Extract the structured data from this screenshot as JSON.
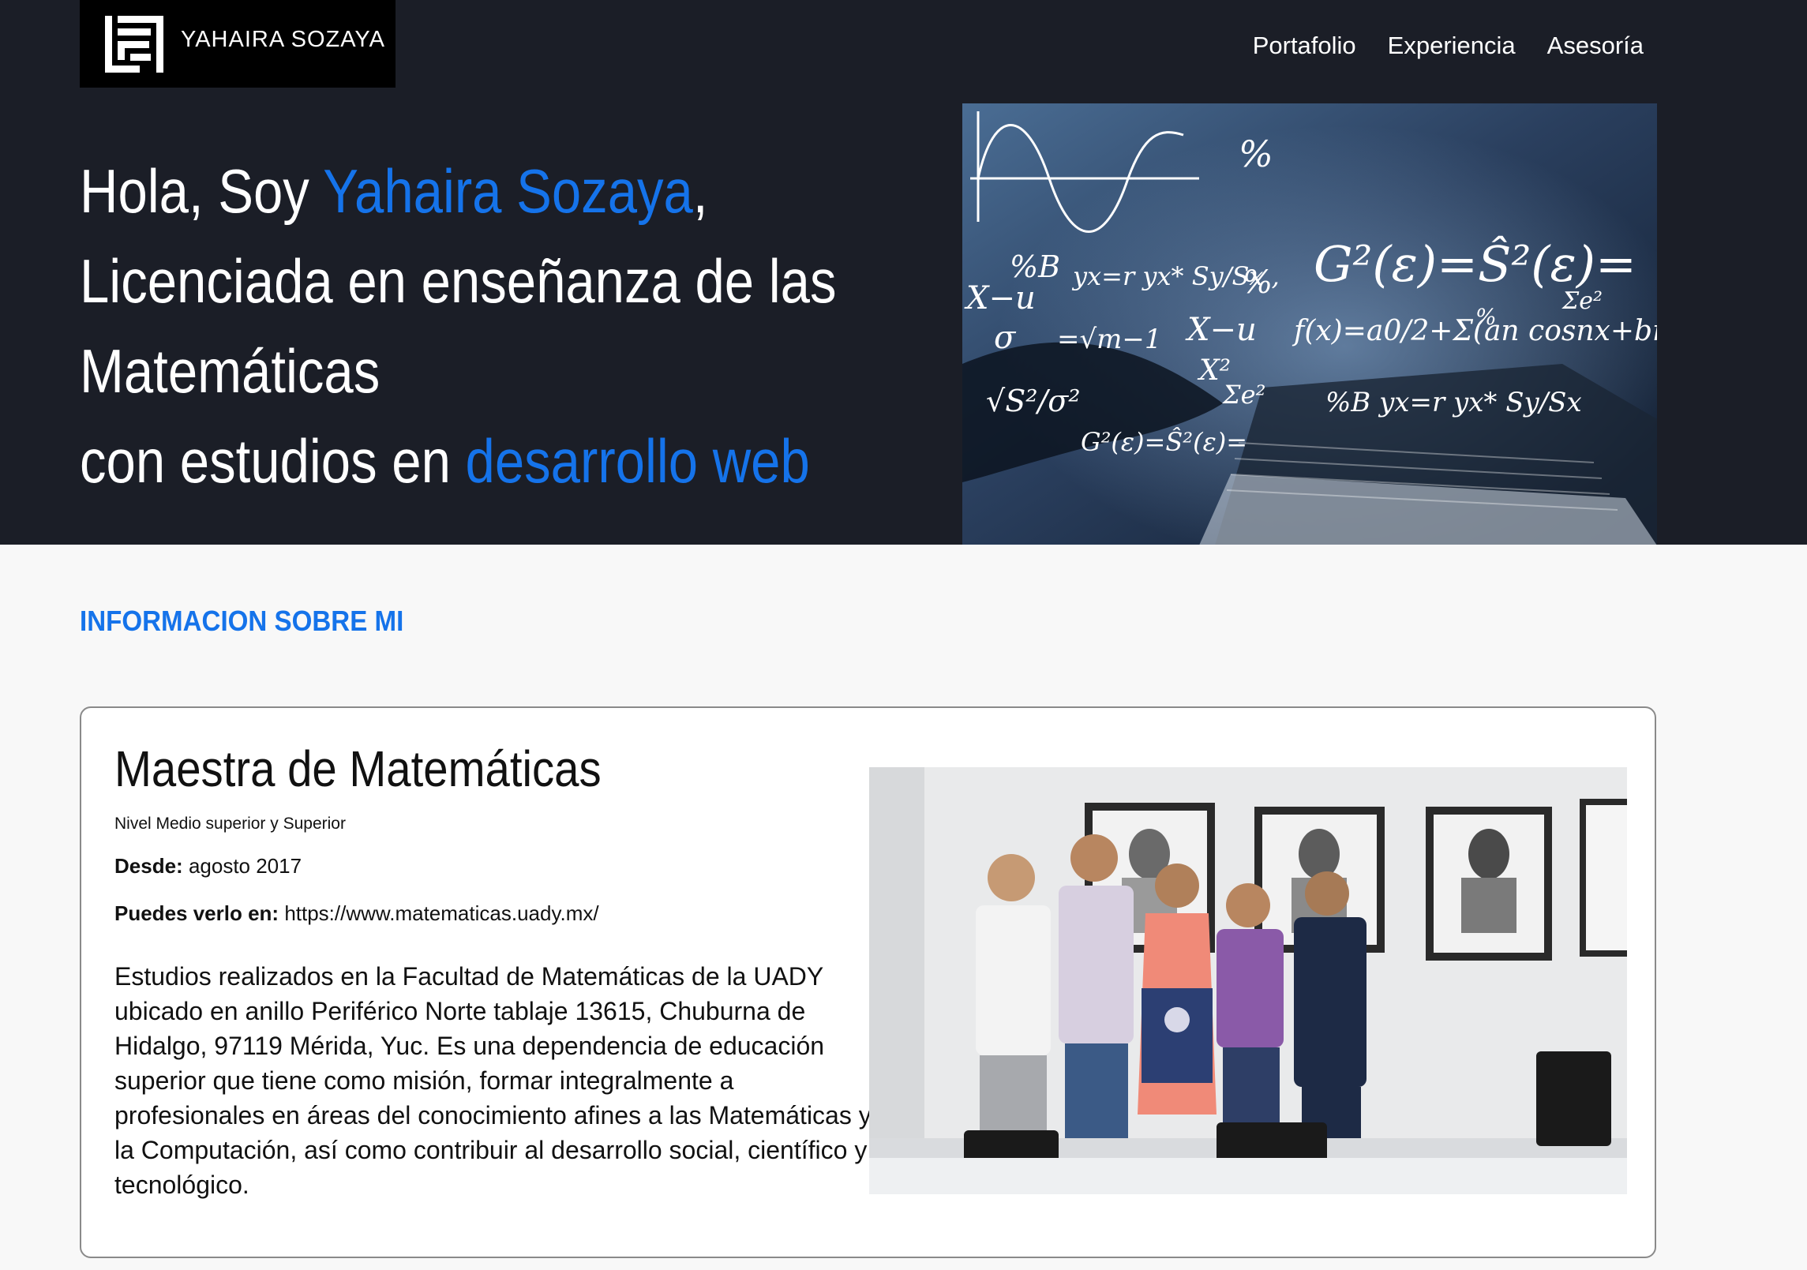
{
  "brand": {
    "name": "YAHAIRA SOZAYA"
  },
  "nav": {
    "items": [
      "Portafolio",
      "Experiencia",
      "Asesoría"
    ]
  },
  "hero": {
    "greeting": "Hola, Soy ",
    "name": "Yahaira Sozaya",
    "comma": ",",
    "line2": "Licenciada en enseñanza de las",
    "line3": "Matemáticas",
    "line4_prefix": "con estudios en ",
    "line4_highlight": "desarrollo web"
  },
  "about": {
    "section_title": "INFORMACION SOBRE MI",
    "card": {
      "title": "Maestra de Matemáticas",
      "subtitle": "Nivel Medio superior y Superior",
      "since_label": "Desde:",
      "since_value": "agosto 2017",
      "url_label": "Puedes verlo en:",
      "url_value": "https://www.matematicas.uady.mx/",
      "description": "Estudios realizados en la Facultad de Matemáticas de la UADY ubicado en anillo Periférico Norte tablaje 13615, Chuburna de Hidalgo, 97119 Mérida, Yuc. Es una dependencia de educación superior que tiene como misión, formar integralmente a profesionales en áreas del conocimiento afines a las Matemáticas y la Computación, así como contribuir al desarrollo social, científico y tecnológico."
    }
  },
  "colors": {
    "accent": "#1573ea",
    "hero_bg": "#1b1e27",
    "page_bg": "#f8f8f8"
  },
  "icons": {
    "logo": "brand-logo-mark"
  }
}
